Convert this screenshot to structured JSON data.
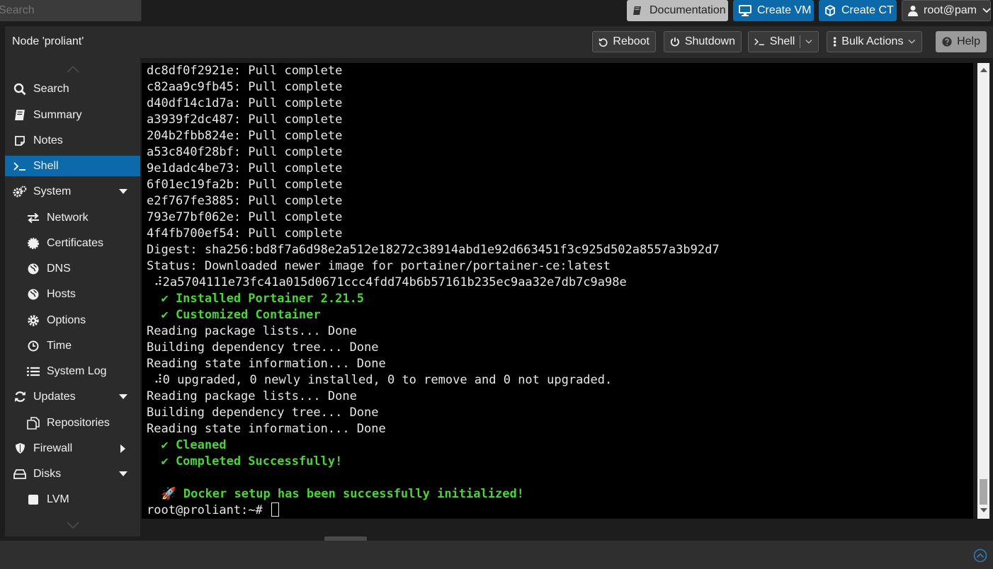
{
  "topbar": {
    "search_placeholder": "Search",
    "documentation_label": "Documentation",
    "create_vm_label": "Create VM",
    "create_ct_label": "Create CT",
    "user_label": "root@pam"
  },
  "header": {
    "title": "Node 'proliant'",
    "reboot_label": "Reboot",
    "shutdown_label": "Shutdown",
    "shell_label": "Shell",
    "bulk_actions_label": "Bulk Actions",
    "help_label": "Help"
  },
  "sidebar": {
    "items": [
      {
        "label": "Search",
        "icon": "search-icon"
      },
      {
        "label": "Summary",
        "icon": "book-icon"
      },
      {
        "label": "Notes",
        "icon": "note-icon"
      },
      {
        "label": "Shell",
        "icon": "terminal-icon",
        "active": true
      },
      {
        "label": "System",
        "icon": "gears-icon",
        "expanded": true
      },
      {
        "label": "Network",
        "icon": "exchange-icon"
      },
      {
        "label": "Certificates",
        "icon": "certificate-icon"
      },
      {
        "label": "DNS",
        "icon": "globe-icon"
      },
      {
        "label": "Hosts",
        "icon": "globe-icon"
      },
      {
        "label": "Options",
        "icon": "gear-icon"
      },
      {
        "label": "Time",
        "icon": "clock-icon"
      },
      {
        "label": "System Log",
        "icon": "list-icon"
      },
      {
        "label": "Updates",
        "icon": "refresh-icon",
        "expanded": true
      },
      {
        "label": "Repositories",
        "icon": "files-icon"
      },
      {
        "label": "Firewall",
        "icon": "shield-icon",
        "expanded": false
      },
      {
        "label": "Disks",
        "icon": "hdd-icon",
        "expanded": true
      },
      {
        "label": "LVM",
        "icon": "square-icon"
      }
    ]
  },
  "terminal": {
    "lines": [
      "dc8df0f2921e: Pull complete",
      "c82aa9c9fb45: Pull complete",
      "d40df14c1d7a: Pull complete",
      "a3939f2dc487: Pull complete",
      "204b2fbb824e: Pull complete",
      "a53c840f28bf: Pull complete",
      "9e1dadc4be73: Pull complete",
      "6f01ec19fa2b: Pull complete",
      "e2f767fe3885: Pull complete",
      "793e77bf062e: Pull complete",
      "4f4fb700ef54: Pull complete",
      "Digest: sha256:bd8f7a6d98e2a512e18272c38914abd1e92d663451f3c925d502a8557a3b92d7",
      "Status: Downloaded newer image for portainer/portainer-ce:latest",
      " ⠼2a5704111e73fc41a015d0671ccc4fdd74b6b57161b235ec9aa32e7db7c9a98e",
      "  ✔ Installed Portainer 2.21.5",
      "  ✔ Customized Container",
      "Reading package lists... Done",
      "Building dependency tree... Done",
      "Reading state information... Done",
      " ⠼0 upgraded, 0 newly installed, 0 to remove and 0 not upgraded.",
      "Reading package lists... Done",
      "Building dependency tree... Done",
      "Reading state information... Done",
      "  ✔ Cleaned",
      "  ✔ Completed Successfully!",
      "",
      "  🚀 Docker setup has been successfully initialized!",
      "root@proliant:~# "
    ],
    "green_lines": [
      14,
      15,
      23,
      24,
      26
    ]
  }
}
